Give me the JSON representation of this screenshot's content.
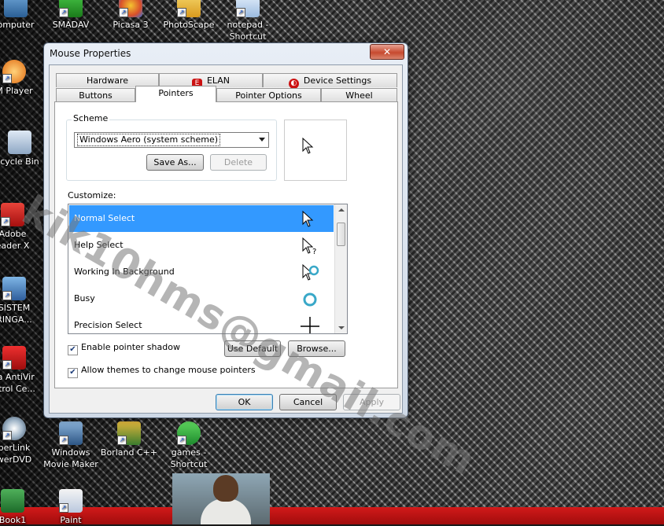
{
  "desktop": {
    "icons": [
      {
        "label1": "omputer",
        "label2": "",
        "icon": "computer-icon"
      },
      {
        "label1": "SMADAV",
        "label2": "",
        "icon": "smadav-icon"
      },
      {
        "label1": "Picasa 3",
        "label2": "",
        "icon": "picasa-icon"
      },
      {
        "label1": "PhotoScape",
        "label2": "",
        "icon": "photoscape-icon"
      },
      {
        "label1": "notepad -",
        "label2": "Shortcut",
        "icon": "notepad-icon"
      },
      {
        "label1": "M Player",
        "label2": "",
        "icon": "media-player-icon"
      },
      {
        "label1": "cycle Bin",
        "label2": "",
        "icon": "recycle-bin-icon"
      },
      {
        "label1": "Adobe",
        "label2": "eader X",
        "icon": "adobe-reader-icon"
      },
      {
        "label1": "SISTEM",
        "label2": "RINGA...",
        "icon": "sistem-icon"
      },
      {
        "label1": "ra AntiVir",
        "label2": "ntrol Ce...",
        "icon": "antivir-icon"
      },
      {
        "label1": "berLink",
        "label2": "werDVD",
        "icon": "powerdvd-icon"
      },
      {
        "label1": "Windows",
        "label2": "Movie Maker",
        "icon": "movie-maker-icon"
      },
      {
        "label1": "Borland C++",
        "label2": "",
        "icon": "borland-icon"
      },
      {
        "label1": "games -",
        "label2": "Shortcut",
        "icon": "games-icon"
      },
      {
        "label1": "Book1",
        "label2": "",
        "icon": "excel-icon"
      },
      {
        "label1": "Paint",
        "label2": "",
        "icon": "paint-icon"
      }
    ]
  },
  "watermark": "kik10hms@gmail.com",
  "dialog": {
    "title": "Mouse Properties",
    "close_label": "✕",
    "tabs_row1": [
      {
        "label": "Hardware"
      },
      {
        "label": "ELAN"
      },
      {
        "label": "Device Settings"
      }
    ],
    "tabs_row2": [
      {
        "label": "Buttons"
      },
      {
        "label": "Pointers"
      },
      {
        "label": "Pointer Options"
      },
      {
        "label": "Wheel"
      }
    ],
    "scheme": {
      "legend": "Scheme",
      "selected": "Windows Aero (system scheme)",
      "save_as": "Save As...",
      "delete": "Delete"
    },
    "customize": {
      "label": "Customize:",
      "items": [
        {
          "label": "Normal Select",
          "cursor": "arrow-cursor-icon"
        },
        {
          "label": "Help Select",
          "cursor": "help-cursor-icon"
        },
        {
          "label": "Working In Background",
          "cursor": "working-cursor-icon"
        },
        {
          "label": "Busy",
          "cursor": "busy-cursor-icon"
        },
        {
          "label": "Precision Select",
          "cursor": "crosshair-cursor-icon"
        }
      ]
    },
    "enable_shadow": "Enable pointer shadow",
    "allow_themes": "Allow themes to change mouse pointers",
    "use_default": "Use Default",
    "browse": "Browse...",
    "ok": "OK",
    "cancel": "Cancel",
    "apply": "Apply"
  }
}
